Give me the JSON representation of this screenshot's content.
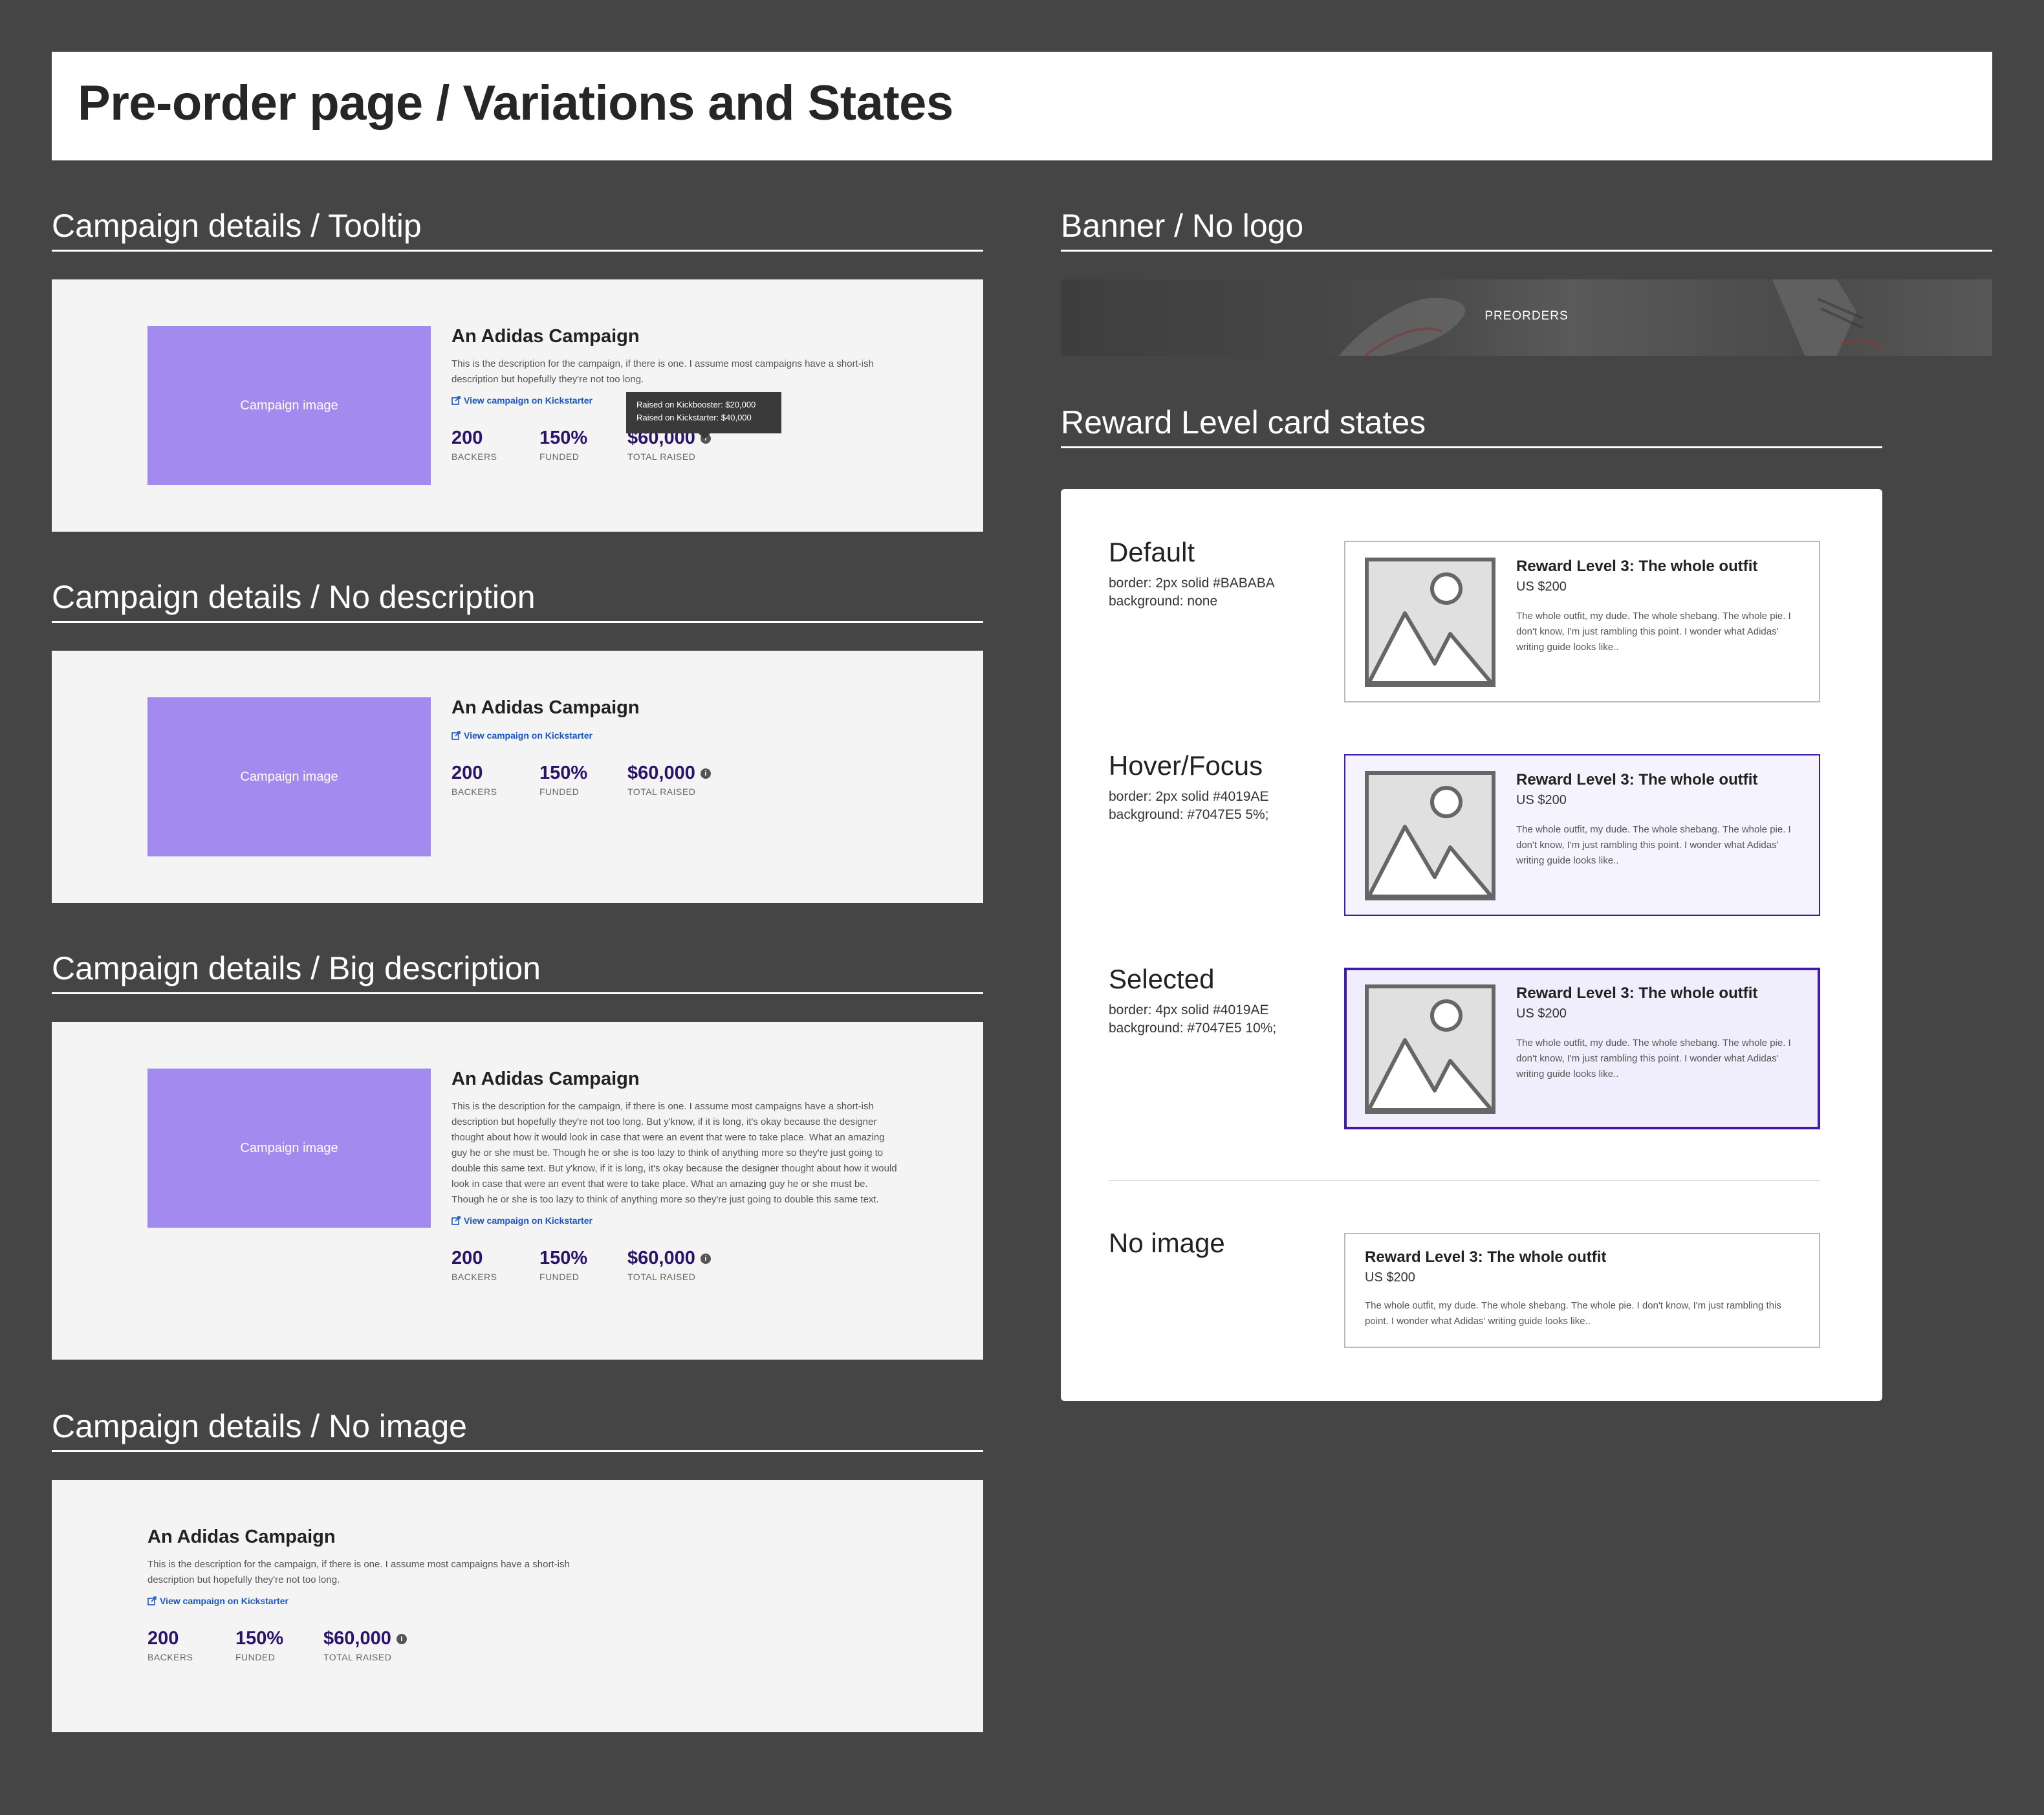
{
  "page": {
    "title": "Pre-order page / Variations and States"
  },
  "sections": {
    "tooltip": "Campaign details / Tooltip",
    "no_description": "Campaign details / No description",
    "big_description": "Campaign details / Big description",
    "no_image": "Campaign details / No image",
    "banner": "Banner / No logo",
    "reward_states": "Reward Level card states"
  },
  "campaign": {
    "image_placeholder": "Campaign image",
    "title": "An Adidas Campaign",
    "description": "This is the description for the campaign, if there is one. I assume most campaigns have a short-ish description but hopefully they're not too long.",
    "big_description": "This is the description for the campaign, if there is one. I assume most campaigns have a short-ish description but hopefully they're not too long. But y'know, if it is long, it's okay because the designer thought about how it would look in case that were an event that were to take place. What an amazing guy he or she must be. Though he or she is too lazy to think of anything more so they're just going to double this same text. But y'know, if it is long, it's okay because the designer thought about how it would look in case that were an event that were to take place. What an amazing guy he or she must be. Though he or she is too lazy to think of anything more so they're just going to double this same text.",
    "link_label": "View campaign on Kickstarter",
    "stats": {
      "backers_value": "200",
      "backers_label": "BACKERS",
      "funded_value": "150%",
      "funded_label": "FUNDED",
      "raised_value": "$60,000",
      "raised_label": "TOTAL RAISED"
    },
    "info_icon": "i",
    "tooltip_lines": [
      "Raised on Kickbooster: $20,000",
      "Raised on Kickstarter: $40,000"
    ]
  },
  "banner": {
    "label": "PREORDERS"
  },
  "reward_states": [
    {
      "name": "Default",
      "spec": [
        "border: 2px solid #BABABA",
        "background: none"
      ],
      "border": "#BABABA",
      "background": "#ffffff"
    },
    {
      "name": "Hover/Focus",
      "spec": [
        "border: 2px solid #4019AE",
        "background: #7047E5 5%;"
      ],
      "border": "#4019AE",
      "background": "#f5f3fd"
    },
    {
      "name": "Selected",
      "spec": [
        "border: 4px solid #4019AE",
        "background: #7047E5 10%;"
      ],
      "border": "#4019AE",
      "background": "#f0edfc"
    },
    {
      "name": "No image",
      "spec": [],
      "border": "#BABABA",
      "background": "#ffffff"
    }
  ],
  "reward": {
    "title": "Reward Level 3: The whole outfit",
    "price": "US $200",
    "description": "The whole outfit, my dude. The whole shebang. The whole pie. I don't know, I'm just rambling this point. I wonder what Adidas' writing guide looks like..",
    "image_icon": "image-placeholder-icon"
  },
  "colors": {
    "page_bg": "#454545",
    "campaign_image": "#A38AEE",
    "stat_value": "#29146A",
    "link": "#1A56C4"
  }
}
